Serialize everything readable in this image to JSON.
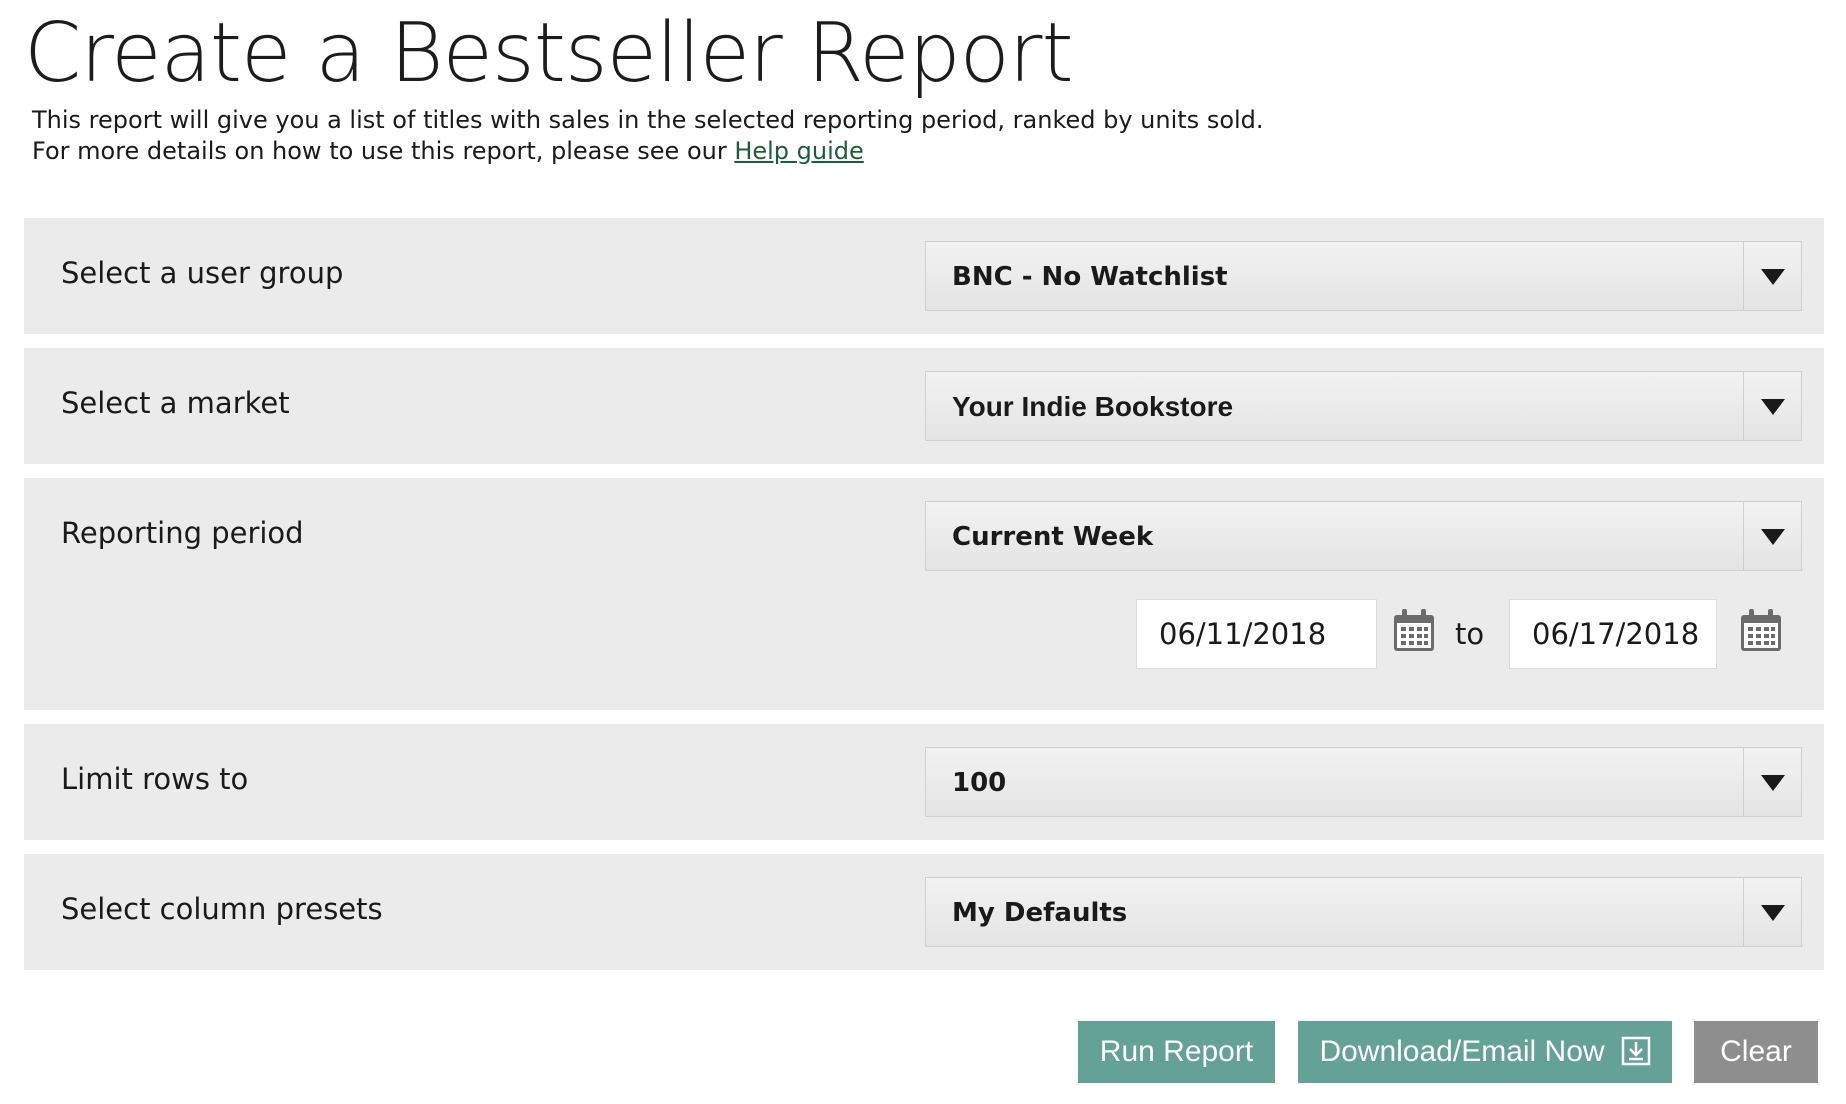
{
  "header": {
    "title": "Create a Bestseller Report",
    "intro_line1": "This report will give you a list of titles with sales in the selected reporting period, ranked by units sold.",
    "intro_line2_prefix": "For more details on how to use this report, please see our ",
    "help_link": "Help guide"
  },
  "form": {
    "user_group": {
      "label": "Select a user group",
      "value": "BNC - No Watchlist"
    },
    "market": {
      "label": "Select a market",
      "value": "Your Indie Bookstore"
    },
    "reporting_period": {
      "label": "Reporting period",
      "value": "Current Week",
      "start_date": "06/11/2018",
      "to_label": "to",
      "end_date": "06/17/2018"
    },
    "limit_rows": {
      "label": "Limit rows to",
      "value": "100"
    },
    "column_presets": {
      "label": "Select column presets",
      "value": "My Defaults"
    }
  },
  "actions": {
    "run": "Run Report",
    "download": "Download/Email Now",
    "clear": "Clear"
  },
  "icons": {
    "dropdown": "triangle-down-icon",
    "calendar": "calendar-icon",
    "download": "download-icon"
  },
  "colors": {
    "row_background": "#ebebeb",
    "primary_button": "#63a294",
    "secondary_button": "#8e8e8e",
    "link": "#1d5e3a"
  }
}
